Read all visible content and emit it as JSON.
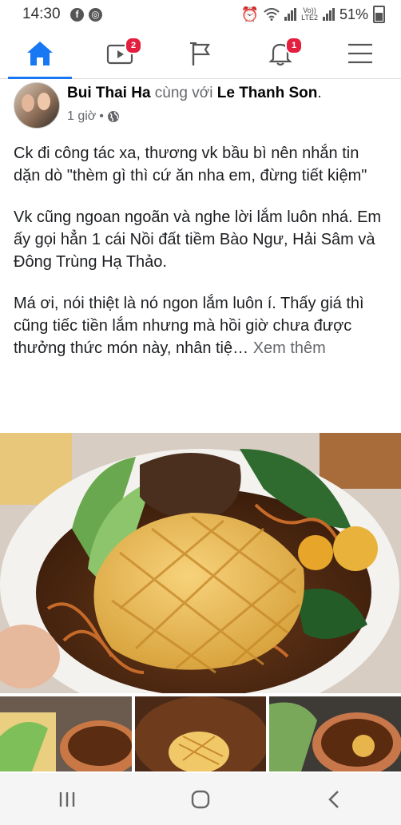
{
  "status_bar": {
    "time": "14:30",
    "network_label_top": "Vo))",
    "network_label_bottom": "LTE2",
    "battery": "51%"
  },
  "nav": {
    "video_badge": "2",
    "notifications_badge": "1"
  },
  "post": {
    "author": "Bui Thai Ha",
    "with_text": "cùng với",
    "tagged": "Le Thanh Son",
    "period": ".",
    "time": "1 giờ",
    "separator": "•",
    "paragraphs": [
      "Ck đi công tác xa, thương vk bầu bì nên nhắn tin dặn dò \"thèm gì thì cứ ăn nha em, đừng tiết kiệm\"",
      "Vk cũng ngoan ngoãn và nghe lời lắm luôn nhá. Em ấy gọi hẳn 1 cái Nồi đất tiềm Bào Ngư, Hải Sâm và Đông Trùng Hạ Thảo."
    ],
    "last_paragraph": "Má ơi, nói thiệt là nó ngon lắm luôn í. Thấy giá thì cũng tiếc tiền lắm nhưng mà hồi giờ chưa được thưởng thức món này, nhân tiệ…",
    "see_more": "Xem thêm"
  },
  "colors": {
    "accent": "#1877f2",
    "badge": "#e41e3f",
    "secondary_text": "#65676b"
  },
  "icons": [
    "home-icon",
    "video-icon",
    "pages-flag-icon",
    "bell-icon",
    "menu-icon",
    "globe-icon",
    "recent-apps-icon",
    "home-circle-icon",
    "back-icon"
  ]
}
